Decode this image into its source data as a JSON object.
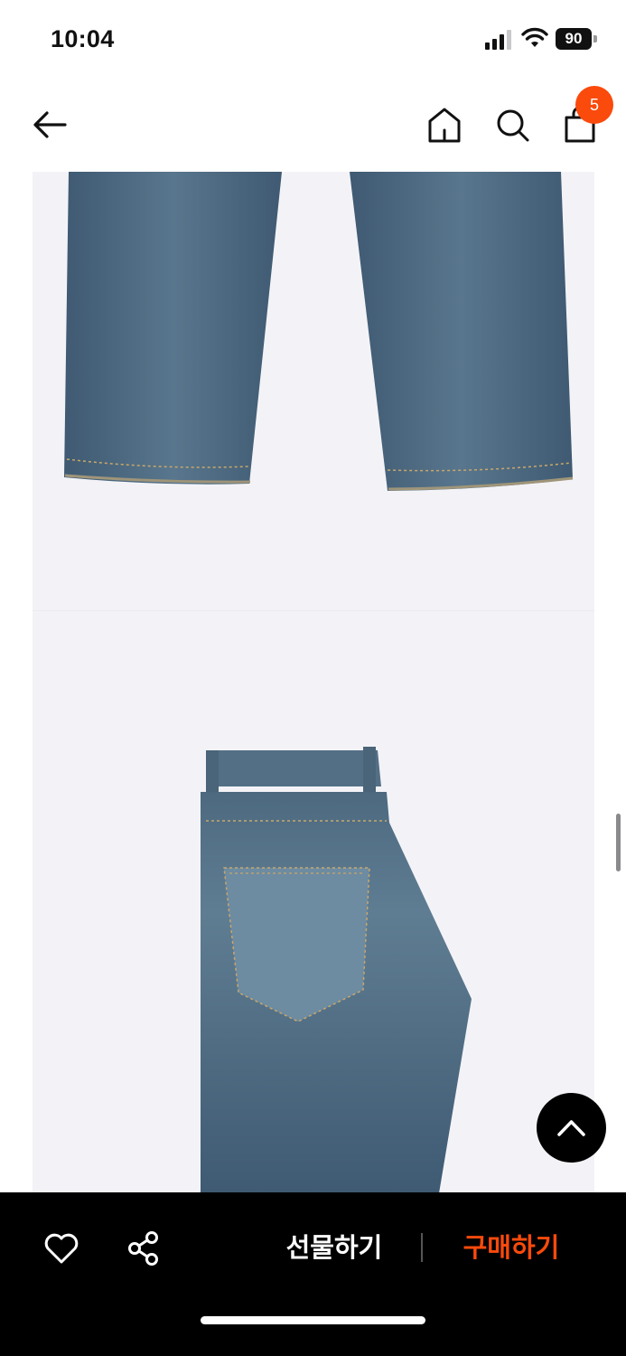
{
  "status_bar": {
    "time": "10:04",
    "battery_level": "90"
  },
  "header": {
    "back_icon": "arrow-left-icon",
    "home_icon": "home-icon",
    "search_icon": "search-icon",
    "bag_icon": "shopping-bag-icon",
    "cart_count": "5"
  },
  "product_images": [
    {
      "icon": "jeans-legs-photo"
    },
    {
      "icon": "jeans-back-pocket-photo"
    }
  ],
  "bottom_bar": {
    "like_icon": "heart-icon",
    "share_icon": "share-icon",
    "gift_label": "선물하기",
    "buy_label": "구매하기"
  },
  "colors": {
    "accent": "#fa4a0c",
    "bar_background": "#000000",
    "image_background": "#f3f3f7",
    "denim": "#4b6880"
  }
}
